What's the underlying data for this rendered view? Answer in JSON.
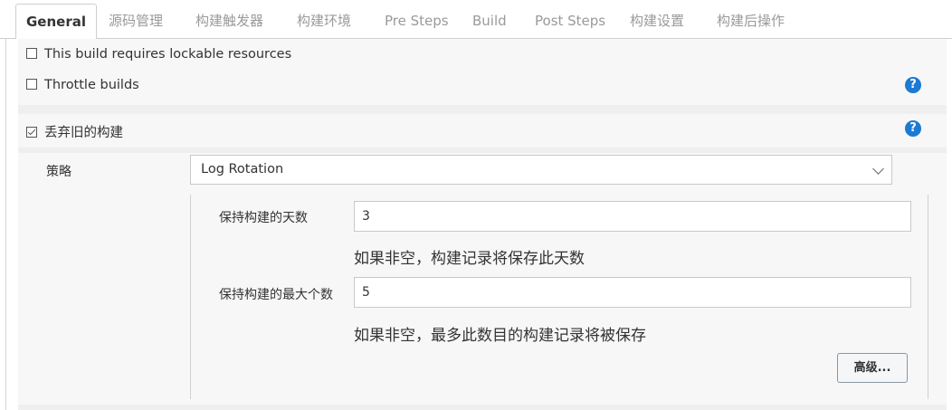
{
  "tabs": [
    {
      "label": "General",
      "active": true
    },
    {
      "label": "源码管理"
    },
    {
      "label": "构建触发器"
    },
    {
      "label": "构建环境"
    },
    {
      "label": "Pre Steps"
    },
    {
      "label": "Build"
    },
    {
      "label": "Post Steps"
    },
    {
      "label": "构建设置"
    },
    {
      "label": "构建后操作"
    }
  ],
  "options": {
    "lockable": {
      "label": "This build requires lockable resources",
      "checked": false
    },
    "throttle": {
      "label": "Throttle builds",
      "checked": false
    },
    "discard": {
      "label": "丢弃旧的构建",
      "checked": true
    }
  },
  "help_icon": "?",
  "strategy": {
    "label": "策略",
    "selected": "Log Rotation"
  },
  "days_to_keep": {
    "label": "保持构建的天数",
    "value": "3",
    "hint": "如果非空，构建记录将保存此天数"
  },
  "num_to_keep": {
    "label": "保持构建的最大个数",
    "value": "5",
    "hint": "如果非空，最多此数目的构建记录将被保存"
  },
  "advanced_button": "高级..."
}
